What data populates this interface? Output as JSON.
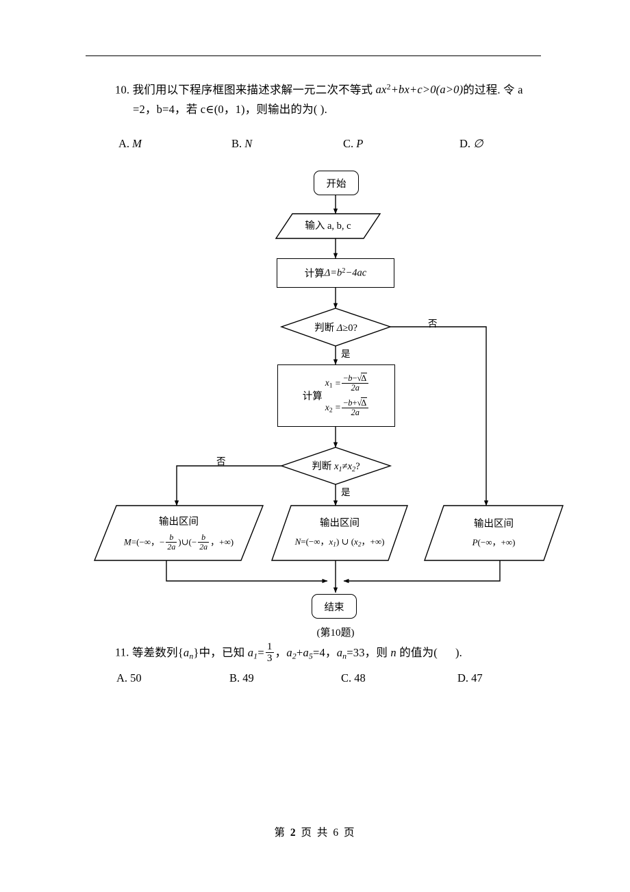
{
  "page": {
    "footer_prefix": "第",
    "footer_page": "2",
    "footer_mid": "页 共",
    "footer_total": "6",
    "footer_suffix": "页"
  },
  "question10": {
    "number": "10.",
    "line1_a": "我们用以下程序框图来描述求解一元二次不等式 ",
    "line1_expr": "ax²+bx+c>0(a>0)",
    "line1_b": "的过程. 令 a",
    "line2": "=2，b=4，若 c∈(0，1)，则输出的为(        ).",
    "options": [
      {
        "key": "A.",
        "value": "M"
      },
      {
        "key": "B.",
        "value": "N"
      },
      {
        "key": "C.",
        "value": "P"
      },
      {
        "key": "D.",
        "value": "∅"
      }
    ]
  },
  "question11": {
    "number": "11.",
    "text_a": "等差数列{a",
    "text_sub": "n",
    "text_b": "}中，已知 a",
    "a1_sub": "1",
    "eq1": "=",
    "frac_num": "1",
    "frac_den": "3",
    "text_c": "，a",
    "a2_sub": "2",
    "plus": "+a",
    "a5_sub": "5",
    "eq2": "=4，a",
    "an_sub": "n",
    "eq3": "=33，则 n 的值为(        ).",
    "options": [
      {
        "key": "A.",
        "value": "50"
      },
      {
        "key": "B.",
        "value": "49"
      },
      {
        "key": "C.",
        "value": "48"
      },
      {
        "key": "D.",
        "value": "47"
      }
    ]
  },
  "flowchart": {
    "caption": "(第10题)",
    "start": "开始",
    "input": "输入 a, b, c",
    "compute_delta_label": "计算 ",
    "compute_delta_expr": "Δ=b²−4ac",
    "decision1": "判断 Δ≥0?",
    "decision1_yes": "是",
    "decision1_no": "否",
    "compute_roots_label": "计算",
    "root1_lhs": "x₁",
    "root1_eq": "=",
    "root1_num": "−b−√Δ",
    "root1_den": "2a",
    "root2_lhs": "x₂",
    "root2_eq": "=",
    "root2_num": "−b+√Δ",
    "root2_den": "2a",
    "decision2": "判断 x₁≠x₂?",
    "decision2_yes": "是",
    "decision2_no": "否",
    "output_title": "输出区间",
    "output_m": "M=(−∞，− b/2a)∪(− b/2a，+∞)",
    "output_m_prefix": "M=(−∞，−",
    "output_m_mid": ")∪(−",
    "output_m_suffix": "，+∞)",
    "output_m_num": "b",
    "output_m_den": "2a",
    "output_n": "N=(−∞，x₁)∪(x₂，+∞)",
    "output_p": "P(−∞，+∞)",
    "end": "结束"
  },
  "colors": {
    "ink": "#000000",
    "paper": "#ffffff"
  }
}
